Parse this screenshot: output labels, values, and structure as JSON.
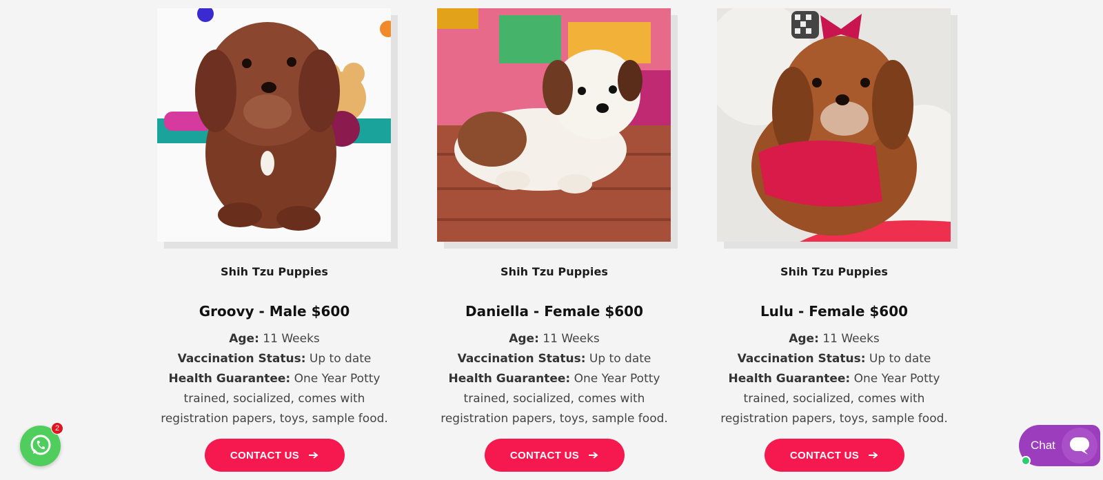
{
  "listings": [
    {
      "category": "Shih Tzu Puppies",
      "title": "Groovy - Male $600",
      "age_label": "Age:",
      "age": "11 Weeks",
      "vaccination_label": "Vaccination Status:",
      "vaccination": "Up to date",
      "health_label": "Health Guarantee:",
      "health": "One Year Potty trained, socialized, comes with registration papers, toys, sample food.",
      "button": "CONTACT US"
    },
    {
      "category": "Shih Tzu Puppies",
      "title": "Daniella - Female $600",
      "age_label": "Age:",
      "age": "11 Weeks",
      "vaccination_label": "Vaccination Status:",
      "vaccination": "Up to date",
      "health_label": "Health Guarantee:",
      "health": "One Year Potty trained, socialized, comes with registration papers, toys, sample food.",
      "button": "CONTACT US"
    },
    {
      "category": "Shih Tzu Puppies",
      "title": "Lulu - Female $600",
      "age_label": "Age:",
      "age": "11 Weeks",
      "vaccination_label": "Vaccination Status:",
      "vaccination": "Up to date",
      "health_label": "Health Guarantee:",
      "health": "One Year Potty trained, socialized, comes with registration papers, toys, sample food.",
      "button": "CONTACT US"
    }
  ],
  "whatsapp": {
    "icon": "whatsapp-icon",
    "badge": "2",
    "color": "#4fce5d"
  },
  "chat": {
    "label": "Chat",
    "icon": "chat-bubble-icon",
    "color": "#9b3dbd"
  },
  "colors": {
    "accent": "#f5194f",
    "background": "#f4f4f4"
  }
}
